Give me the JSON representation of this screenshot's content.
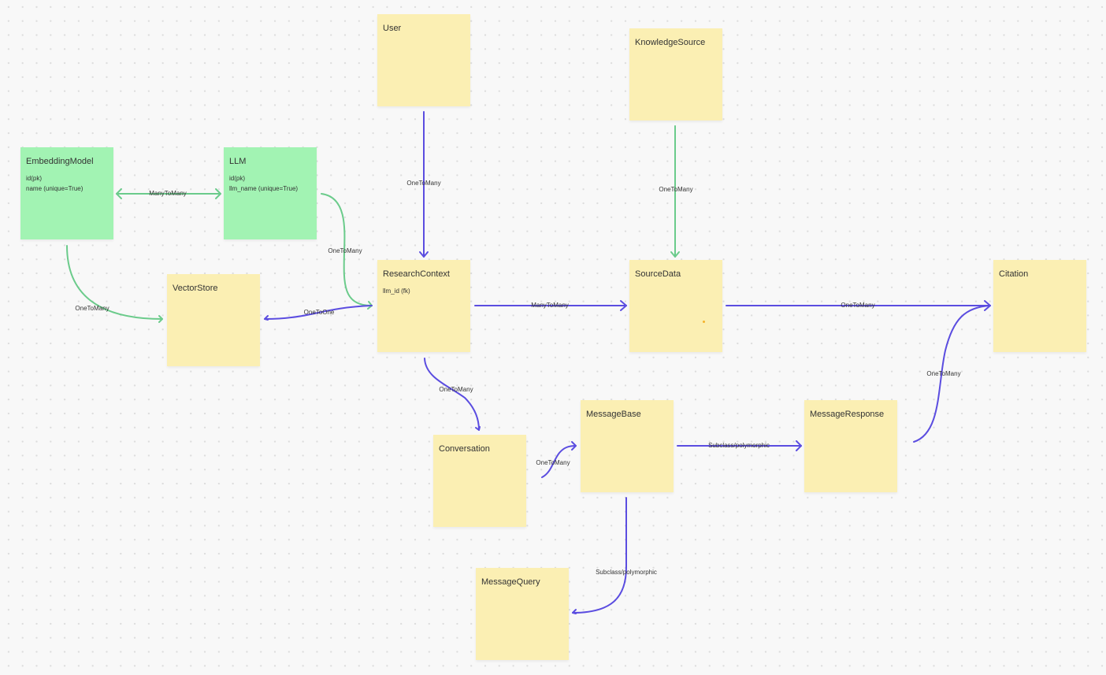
{
  "colors": {
    "entity_yellow": "#fbefb3",
    "entity_green": "#a2f3b3",
    "edge_purple": "#5b4de0",
    "edge_green": "#6bcb8b",
    "marker_orange": "#f5b22a",
    "canvas_bg": "#f8f8f8"
  },
  "nodes": [
    {
      "id": "user",
      "title": "User",
      "color": "yellow",
      "fields": []
    },
    {
      "id": "knowledge-source",
      "title": "KnowledgeSource",
      "color": "yellow",
      "fields": []
    },
    {
      "id": "embedding-model",
      "title": "EmbeddingModel",
      "color": "green",
      "fields": [
        "id(pk)",
        "name (unique=True)"
      ]
    },
    {
      "id": "llm",
      "title": "LLM",
      "color": "green",
      "fields": [
        "id(pk)",
        "llm_name (unique=True)"
      ]
    },
    {
      "id": "vector-store",
      "title": "VectorStore",
      "color": "yellow",
      "fields": []
    },
    {
      "id": "research-context",
      "title": "ResearchContext",
      "color": "yellow",
      "fields": [
        "llm_id (fk)"
      ]
    },
    {
      "id": "source-data",
      "title": "SourceData",
      "color": "yellow",
      "fields": []
    },
    {
      "id": "citation",
      "title": "Citation",
      "color": "yellow",
      "fields": []
    },
    {
      "id": "conversation",
      "title": "Conversation",
      "color": "yellow",
      "fields": []
    },
    {
      "id": "message-base",
      "title": "MessageBase",
      "color": "yellow",
      "fields": []
    },
    {
      "id": "message-response",
      "title": "MessageResponse",
      "color": "yellow",
      "fields": []
    },
    {
      "id": "message-query",
      "title": "MessageQuery",
      "color": "yellow",
      "fields": []
    }
  ],
  "edges": [
    {
      "from": "embedding-model",
      "to": "llm",
      "label": "ManyToMany",
      "color": "green",
      "bidirectional": true
    },
    {
      "from": "embedding-model",
      "to": "vector-store",
      "label": "OneToMany",
      "color": "green"
    },
    {
      "from": "llm",
      "to": "research-context",
      "label": "OneToMany",
      "color": "green"
    },
    {
      "from": "research-context",
      "to": "vector-store",
      "label": "OneToOne",
      "color": "purple"
    },
    {
      "from": "user",
      "to": "research-context",
      "label": "OneToMany",
      "color": "purple"
    },
    {
      "from": "knowledge-source",
      "to": "source-data",
      "label": "OneToMany",
      "color": "green"
    },
    {
      "from": "research-context",
      "to": "source-data",
      "label": "ManyToMany",
      "color": "purple"
    },
    {
      "from": "source-data",
      "to": "citation",
      "label": "OneToMany",
      "color": "purple"
    },
    {
      "from": "message-response",
      "to": "citation",
      "label": "OneToMany",
      "color": "purple"
    },
    {
      "from": "research-context",
      "to": "conversation",
      "label": "OneToMany",
      "color": "purple"
    },
    {
      "from": "conversation",
      "to": "message-base",
      "label": "OneToMany",
      "color": "purple"
    },
    {
      "from": "message-base",
      "to": "message-response",
      "label": "Subclass/polymorphic",
      "color": "purple"
    },
    {
      "from": "message-base",
      "to": "message-query",
      "label": "Subclass/polymorphic",
      "color": "purple"
    }
  ]
}
